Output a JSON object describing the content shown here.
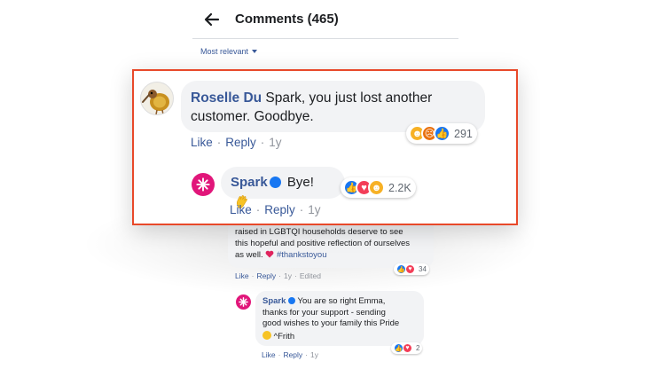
{
  "header": {
    "title": "Comments (465)",
    "sort_label": "Most relevant"
  },
  "featured": {
    "comment": {
      "author": "Roselle Du",
      "text": "Spark, you just lost another customer. Goodbye.",
      "reaction_count": "291",
      "like": "Like",
      "reply": "Reply",
      "age": "1y"
    },
    "reply": {
      "author": "Spark",
      "text": "Bye!",
      "reaction_count": "2.2K",
      "like": "Like",
      "reply": "Reply",
      "age": "1y"
    }
  },
  "background": {
    "comment1": {
      "line1": "raised in LGBTQI households deserve to see",
      "line2": "this hopeful and positive reflection of ourselves",
      "line3": "as well.",
      "hashtag": "#thankstoyou",
      "reaction_count": "34",
      "like": "Like",
      "reply": "Reply",
      "age": "1y",
      "edited": "Edited"
    },
    "comment2": {
      "author": "Spark",
      "line1": "You are so right Emma,",
      "line2": "thanks for your support - sending",
      "line3": "good wishes to your family this Pride",
      "line4": "^Frith",
      "reaction_count": "2",
      "like": "Like",
      "reply": "Reply",
      "age": "1y"
    }
  },
  "colors": {
    "highlight_border": "#e8492a",
    "link_blue": "#385898",
    "spark_pink": "#e1167a",
    "bubble_gray": "#f2f3f5"
  },
  "icons": [
    "back-arrow-icon",
    "caret-down-icon",
    "verified-badge-icon",
    "waving-hand-icon",
    "like-reaction-icon",
    "love-reaction-icon",
    "haha-reaction-icon",
    "angry-reaction-icon",
    "heart-emoji-icon",
    "smile-emoji-icon"
  ]
}
